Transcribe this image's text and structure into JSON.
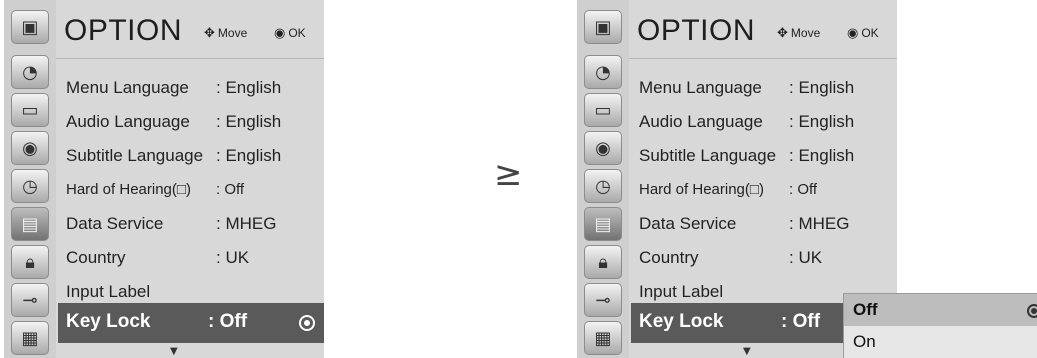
{
  "left": {
    "title": "OPTION",
    "hint_move": "Move",
    "hint_ok": "OK",
    "icons": [
      "setup-icon",
      "picture-icon",
      "audio-icon",
      "time-icon",
      "option-icon",
      "lock-icon",
      "input-icon",
      "usb-icon"
    ],
    "items": [
      {
        "label": "Menu Language",
        "value": ": English"
      },
      {
        "label": "Audio Language",
        "value": ": English"
      },
      {
        "label": "Subtitle Language",
        "value": ": English"
      },
      {
        "label": "Hard of Hearing(□)",
        "value": ": Off"
      },
      {
        "label": "Data Service",
        "value": ": MHEG"
      },
      {
        "label": "Country",
        "value": ": UK"
      },
      {
        "label": "Input Label",
        "value": ""
      }
    ],
    "selected": {
      "label": "Key Lock",
      "value": ": Off"
    }
  },
  "right": {
    "title": "OPTION",
    "hint_move": "Move",
    "hint_ok": "OK",
    "items": [
      {
        "label": "Menu Language",
        "value": ": English"
      },
      {
        "label": "Audio Language",
        "value": ": English"
      },
      {
        "label": "Subtitle Language",
        "value": ": English"
      },
      {
        "label": "Hard of Hearing(□)",
        "value": ": Off"
      },
      {
        "label": "Data Service",
        "value": ": MHEG"
      },
      {
        "label": "Country",
        "value": ": UK"
      },
      {
        "label": "Input Label",
        "value": ""
      }
    ],
    "selected": {
      "label": "Key Lock",
      "value": ": Off"
    },
    "popup": {
      "options": [
        "Off",
        "On"
      ],
      "selected": "Off"
    }
  },
  "between_arrow": "≥"
}
